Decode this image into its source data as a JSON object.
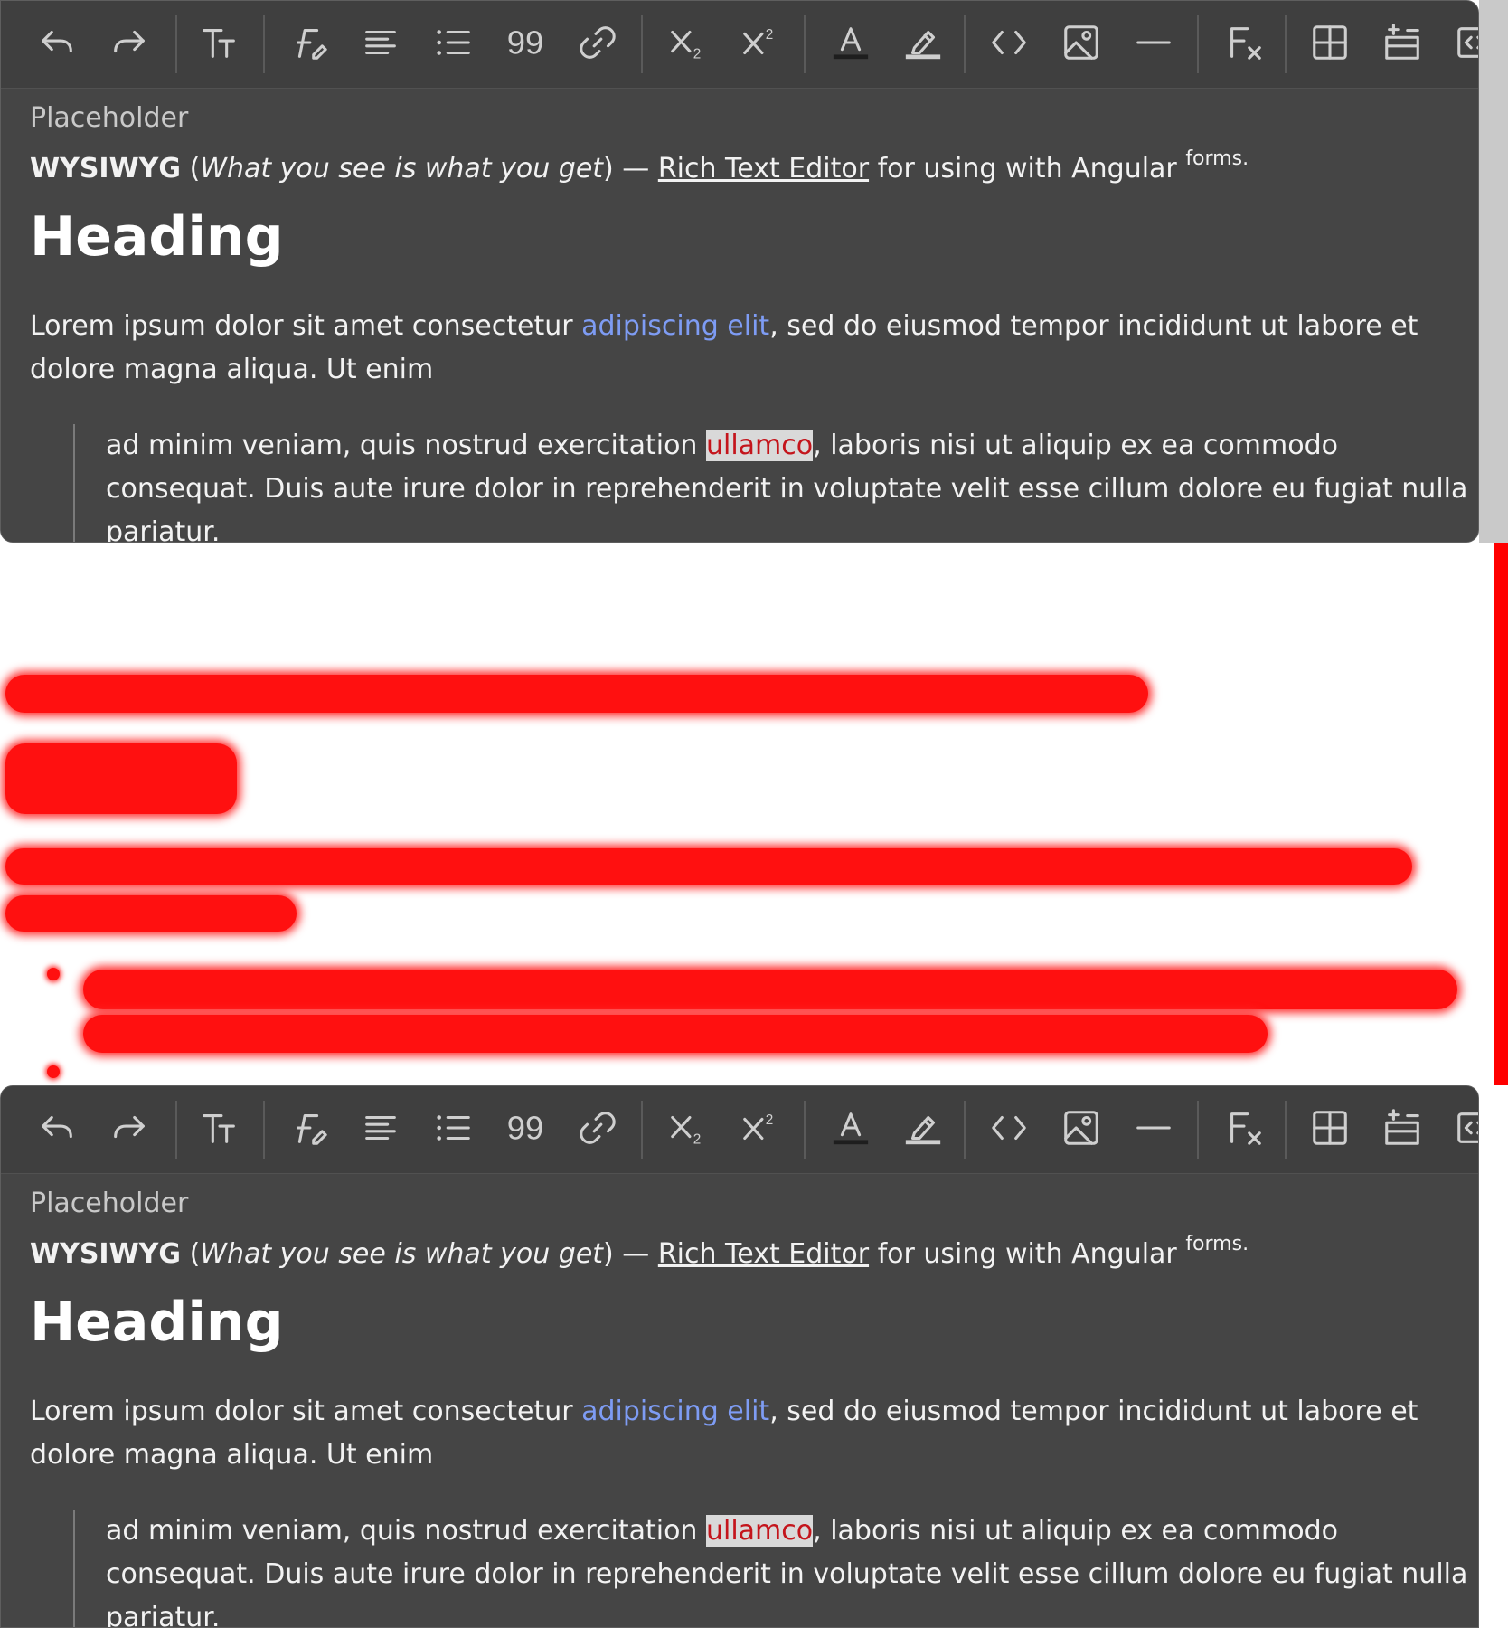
{
  "toolbar": {
    "buttons": [
      {
        "name": "undo-icon"
      },
      {
        "name": "redo-icon"
      },
      {
        "name": "text-size-icon",
        "glyph": "TT"
      },
      {
        "name": "font-icon",
        "glyph": "F"
      },
      {
        "name": "align-icon"
      },
      {
        "name": "bullet-list-icon"
      },
      {
        "name": "quote-icon",
        "glyph": "99"
      },
      {
        "name": "link-icon"
      },
      {
        "name": "subscript-icon",
        "glyph": "X₂"
      },
      {
        "name": "superscript-icon",
        "glyph": "X²"
      },
      {
        "name": "text-color-icon",
        "glyph": "A"
      },
      {
        "name": "highlight-icon"
      },
      {
        "name": "code-icon",
        "glyph": "<>"
      },
      {
        "name": "image-icon"
      },
      {
        "name": "horizontal-rule-icon"
      },
      {
        "name": "clear-format-icon",
        "glyph": "Fx"
      },
      {
        "name": "table-icon"
      },
      {
        "name": "insert-row-icon"
      },
      {
        "name": "embed-icon"
      }
    ]
  },
  "editor": {
    "placeholder": "Placeholder",
    "line1": {
      "bold": "WYSIWYG",
      "open": " (",
      "italic": "What you see is what you get",
      "close": ") — ",
      "link": "Rich Text Editor",
      "rest": " for using with Angular ",
      "sup": "forms."
    },
    "heading": "Heading",
    "para": {
      "before": "Lorem ipsum dolor sit amet consectetur ",
      "link": "adipiscing elit",
      "after": ", sed do eiusmod tempor incididunt ut labore et dolore magna aliqua. Ut enim"
    },
    "quote": {
      "before": "ad minim veniam, quis nostrud exercitation ",
      "mark": "ullamco",
      "after": ", laboris nisi ut aliquip ex ea commodo consequat. Duis aute irure dolor in reprehenderit in voluptate velit esse cillum dolore eu fugiat nulla pariatur."
    }
  },
  "colors": {
    "panel": "#454545",
    "toolbar": "#3f3f3f",
    "link": "#7e9cf4",
    "mark_bg": "#d9d9d9",
    "mark_text": "#c4151c",
    "diff": "#ff0000"
  }
}
